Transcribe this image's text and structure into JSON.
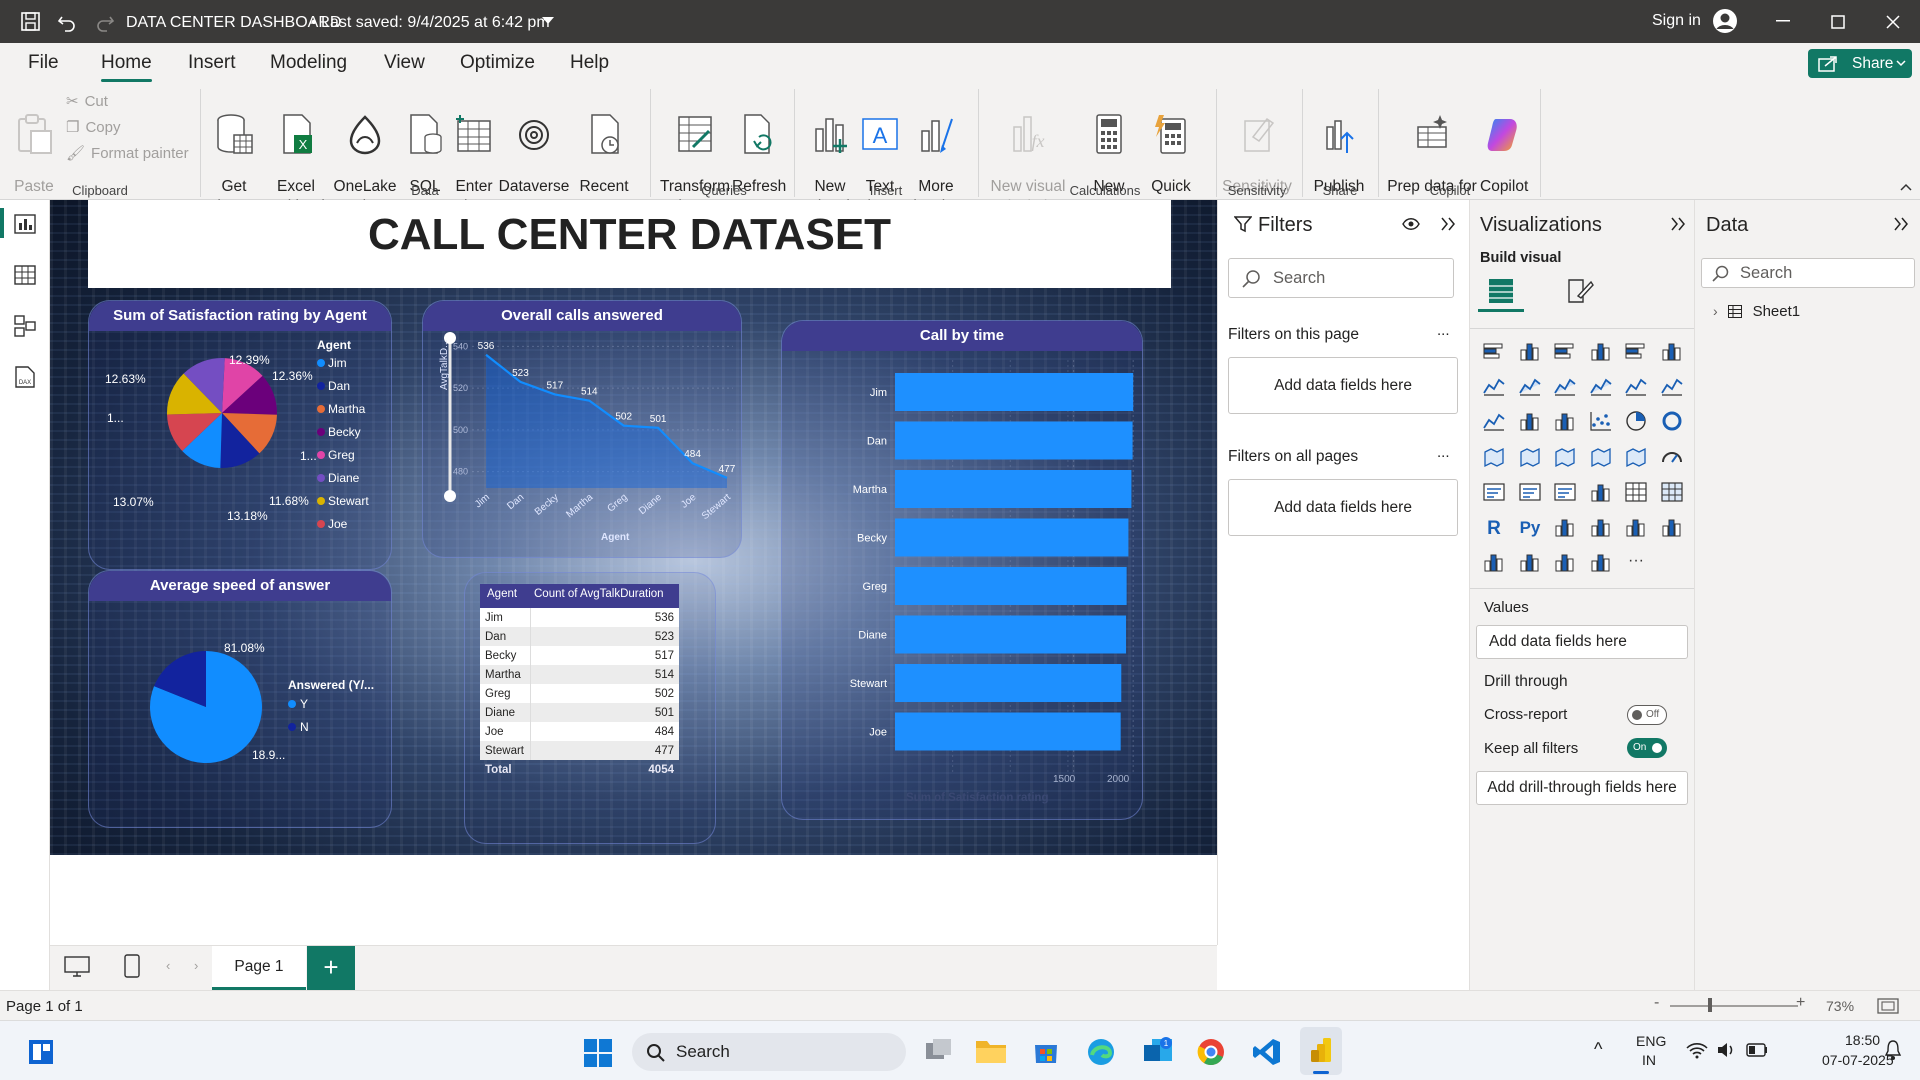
{
  "titlebar": {
    "title": "DATA CENTER DASHBOARD",
    "saved": "•  Last saved: 9/4/2025 at 6:42 pm",
    "signin": "Sign in"
  },
  "menu": {
    "file": "File",
    "home": "Home",
    "insert": "Insert",
    "modeling": "Modeling",
    "view": "View",
    "optimize": "Optimize",
    "help": "Help",
    "share": "Share"
  },
  "ribbon": {
    "paste": "Paste",
    "cut": "Cut",
    "copy": "Copy",
    "format_painter": "Format painter",
    "clipboard": "Clipboard",
    "get_data": "Get\ndata ˅",
    "excel": "Excel\nworkbook",
    "onelake": "OneLake\ncatalog ˅",
    "sql": "SQL\nServer",
    "enter": "Enter\ndata",
    "dataverse": "Dataverse",
    "recent": "Recent\nsources ˅",
    "data_group": "Data",
    "transform": "Transform\ndata ˅",
    "refresh": "Refresh",
    "queries": "Queries",
    "new_visual": "New\nvisual",
    "text_box": "Text\nbox",
    "more_visuals": "More\nvisuals ˅",
    "insert_group": "Insert",
    "new_visual_calc": "New visual\ncalculation ˅",
    "new_measure": "New\nmeasure",
    "quick_measure": "Quick\nmeasure",
    "calculations": "Calculations",
    "sensitivity_btn": "Sensitivity\n˅",
    "sensitivity": "Sensitivity",
    "publish": "Publish",
    "share_group": "Share",
    "prep": "Prep data for\nAI",
    "copilot_btn": "Copilot",
    "copilot_group": "Copilot"
  },
  "report": {
    "title": "CALL CENTER DATASET",
    "pie1": {
      "title": "Sum of Satisfaction rating by Agent",
      "legend_title": "Agent",
      "agents": [
        "Jim",
        "Dan",
        "Martha",
        "Becky",
        "Greg",
        "Diane",
        "Stewart",
        "Joe"
      ],
      "labels": {
        "a": "12.39%",
        "b": "12.36%",
        "c": "12.63%",
        "d": "1...",
        "e": "1...",
        "f": "13.07%",
        "g": "13.18%",
        "h": "11.68%"
      }
    },
    "line": {
      "title": "Overall calls answered",
      "xlabel": "Agent",
      "ylabel": "AvgTalkD...",
      "yticks": [
        "540",
        "520",
        "500",
        "480"
      ]
    },
    "pie2": {
      "title": "Average speed of answer",
      "legend_title": "Answered (Y/...",
      "legend": [
        "Y",
        "N"
      ],
      "label_y": "81.08%",
      "label_n": "18.9..."
    },
    "table": {
      "col1": "Agent",
      "col2": "Count of AvgTalkDuration",
      "total_label": "Total",
      "total_value": "4054"
    },
    "bar": {
      "title": "Call by time",
      "xlabel": "Sum of Satisfaction rating",
      "xticks": [
        "1500",
        "2000"
      ]
    }
  },
  "chart_data": [
    {
      "type": "pie",
      "title": "Sum of Satisfaction rating by Agent",
      "categories": [
        "Jim",
        "Dan",
        "Martha",
        "Becky",
        "Greg",
        "Diane",
        "Stewart",
        "Joe"
      ],
      "values": [
        12.39,
        12.36,
        12.63,
        12.3,
        12.4,
        13.07,
        13.18,
        11.68
      ],
      "colors": [
        "#118DFF",
        "#12239E",
        "#E66C37",
        "#6B007B",
        "#E044A7",
        "#744EC2",
        "#D9B300",
        "#D64550"
      ]
    },
    {
      "type": "line",
      "title": "Overall calls answered",
      "categories": [
        "Jim",
        "Dan",
        "Becky",
        "Martha",
        "Greg",
        "Diane",
        "Joe",
        "Stewart"
      ],
      "values": [
        536,
        523,
        517,
        514,
        502,
        501,
        484,
        477
      ],
      "ylim": [
        475,
        545
      ],
      "xlabel": "Agent"
    },
    {
      "type": "pie",
      "title": "Average speed of answer",
      "categories": [
        "Y",
        "N"
      ],
      "values": [
        81.08,
        18.92
      ],
      "colors": [
        "#118DFF",
        "#12239E"
      ]
    },
    {
      "type": "table",
      "title": "",
      "columns": [
        "Agent",
        "Count of AvgTalkDuration"
      ],
      "rows": [
        [
          "Jim",
          "536"
        ],
        [
          "Dan",
          "523"
        ],
        [
          "Becky",
          "517"
        ],
        [
          "Martha",
          "514"
        ],
        [
          "Greg",
          "502"
        ],
        [
          "Diane",
          "501"
        ],
        [
          "Joe",
          "484"
        ],
        [
          "Stewart",
          "477"
        ]
      ],
      "total": "4054"
    },
    {
      "type": "bar",
      "title": "Call by time",
      "categories": [
        "Jim",
        "Dan",
        "Martha",
        "Becky",
        "Greg",
        "Diane",
        "Stewart",
        "Joe"
      ],
      "values": [
        2000,
        1995,
        1985,
        1960,
        1945,
        1940,
        1900,
        1895
      ],
      "xlim": [
        0,
        2200
      ],
      "xlabel": "Sum of Satisfaction rating"
    }
  ],
  "filters": {
    "title": "Filters",
    "search": "Search",
    "on_page": "Filters on this page",
    "on_all": "Filters on all pages",
    "add": "Add data fields here",
    "dots": "..."
  },
  "viz": {
    "title": "Visualizations",
    "build": "Build visual",
    "values": "Values",
    "add_values": "Add data fields here",
    "drill": "Drill through",
    "cross": "Cross-report",
    "cross_state": "Off",
    "keep": "Keep all filters",
    "keep_state": "On",
    "add_drill": "Add drill-through fields here"
  },
  "data": {
    "title": "Data",
    "search": "Search",
    "sheet": "Sheet1"
  },
  "pages": {
    "page1": "Page 1"
  },
  "status": {
    "page": "Page 1 of 1",
    "zoom": "73%"
  },
  "taskbar": {
    "search": "Search",
    "lang1": "ENG",
    "lang2": "IN",
    "time": "18:50",
    "date": "07-07-2025"
  }
}
